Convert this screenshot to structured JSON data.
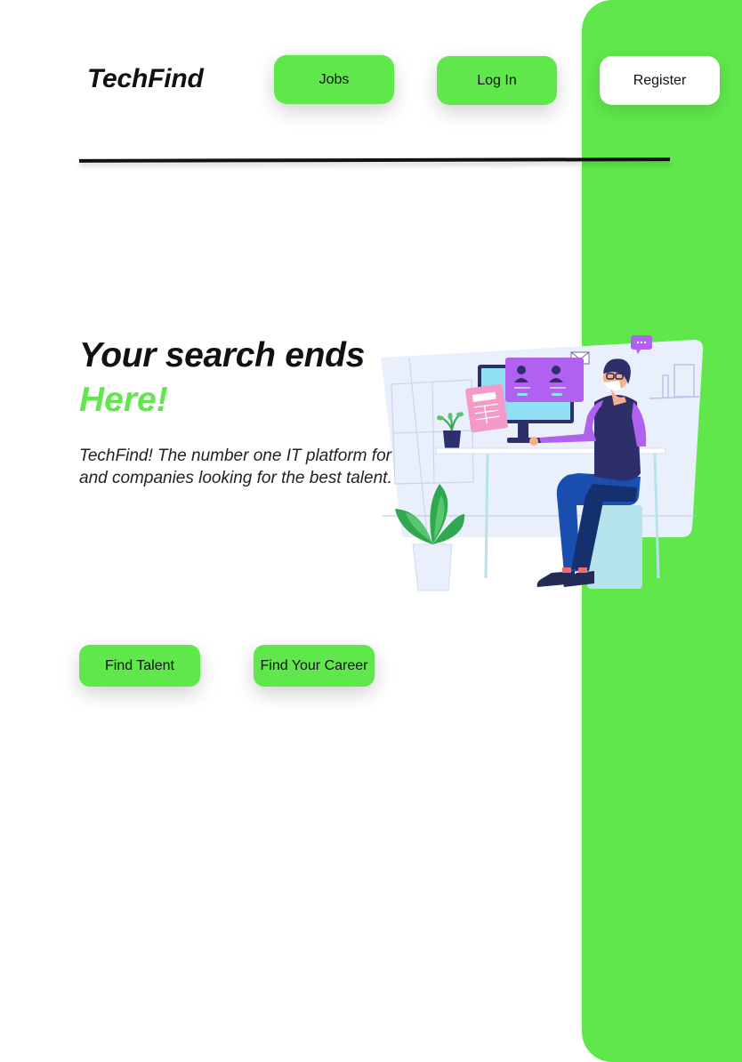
{
  "brand": {
    "name": "TechFind",
    "accent_color": "#5fe74b"
  },
  "nav": {
    "jobs_label": "Jobs",
    "login_label": "Log In",
    "register_label": "Register"
  },
  "hero": {
    "title": "Your search ends",
    "accent": "Here!",
    "description": "TechFind! The number one IT platform for Job seekers and companies looking for the best talent."
  },
  "cta": {
    "find_talent_label": "Find Talent",
    "find_career_label": "Find Your Career"
  },
  "illustration": {
    "icon": "person-at-desk-illustration"
  }
}
